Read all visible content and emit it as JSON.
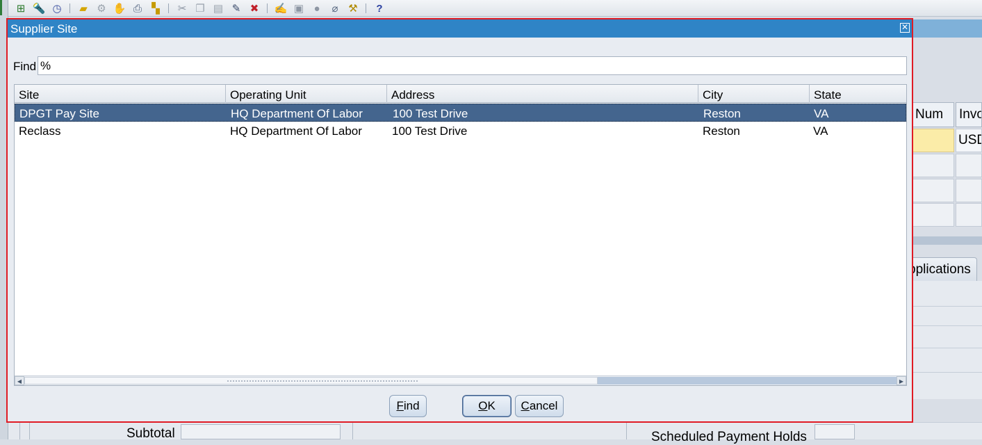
{
  "toolbar": {
    "icons": [
      "new-record-icon",
      "find-icon",
      "navigator-icon",
      "open-folder-icon",
      "save-icon",
      "next-step-icon",
      "switch-responsibility-icon",
      "print-icon",
      "close-form-icon",
      "cut-icon",
      "copy-icon",
      "paste-icon",
      "new-record-2-icon",
      "delete-record-icon",
      "edit-field-icon",
      "zoom-icon",
      "translations-icon",
      "attachments-icon",
      "folder-tools-icon",
      "help-icon"
    ],
    "help_glyph": "?"
  },
  "dialog": {
    "title": "Supplier Site",
    "close_glyph": "✕",
    "find_label": "Find",
    "find_value": "%",
    "columns": [
      "Site",
      "Operating Unit",
      "Address",
      "City",
      "State"
    ],
    "rows": [
      {
        "site": "DPGT Pay Site",
        "operating_unit": "HQ Department Of Labor",
        "address": "100 Test Drive",
        "city": "Reston",
        "state": "VA",
        "selected": true
      },
      {
        "site": "Reclass",
        "operating_unit": "HQ Department Of Labor",
        "address": "100 Test Drive",
        "city": "Reston",
        "state": "VA",
        "selected": false
      }
    ],
    "buttons": {
      "find": {
        "mnemonic": "F",
        "rest": "ind"
      },
      "ok": {
        "mnemonic": "O",
        "rest": "K"
      },
      "cancel": {
        "mnemonic": "C",
        "rest": "ancel"
      }
    },
    "scroll_left_glyph": "◀",
    "scroll_right_glyph": "▶"
  },
  "background": {
    "col_num": "Num",
    "col_invoice": "Invo",
    "currency": "USD",
    "tab_applications": "pplications",
    "subtotal_label": "Subtotal",
    "holds_label": "Scheduled Payment Holds"
  },
  "colors": {
    "title_bar": "#2f84c6",
    "selected_row": "#44658e",
    "focus_border": "#e01b24"
  }
}
